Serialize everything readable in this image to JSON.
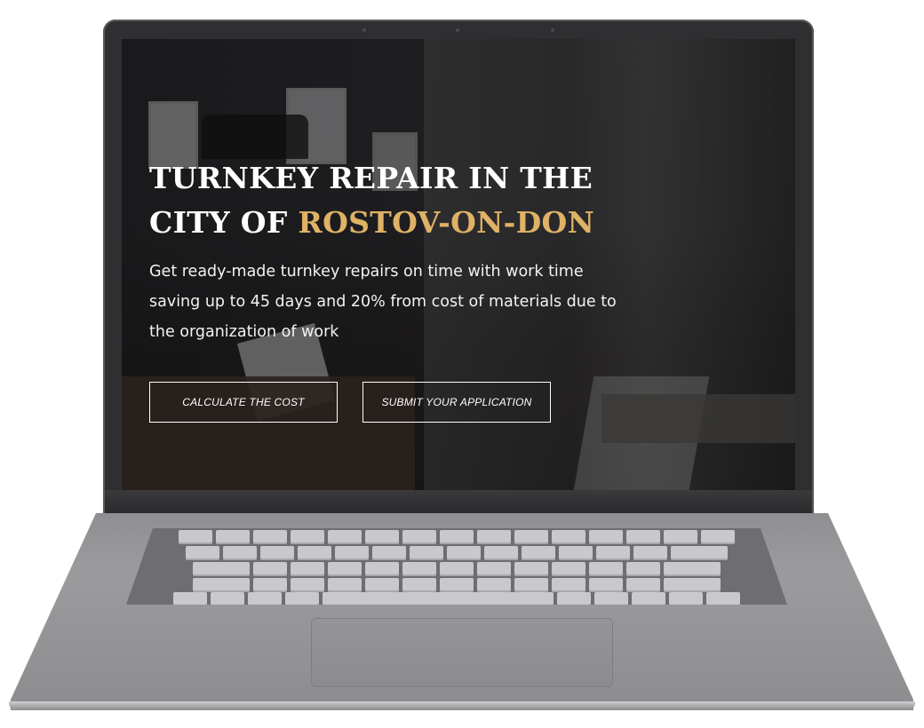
{
  "hero": {
    "title_line1": "TURNKEY REPAIR IN THE",
    "title_line2_prefix": "CITY OF ",
    "title_line2_accent": "ROSTOV-ON-DON",
    "subtitle": "Get ready-made turnkey repairs on time with work time saving up to 45 days and 20% from cost of materials due to the organization of work"
  },
  "buttons": {
    "calculate_label": "CALCULATE THE COST",
    "submit_label": "SUBMIT YOUR APPLICATION"
  },
  "colors": {
    "accent": "#dfb266",
    "text": "#ffffff",
    "bezel": "#2f2f31",
    "chassis": "#9b9b9d"
  },
  "icons": {
    "camera": "camera-dot-icon"
  }
}
